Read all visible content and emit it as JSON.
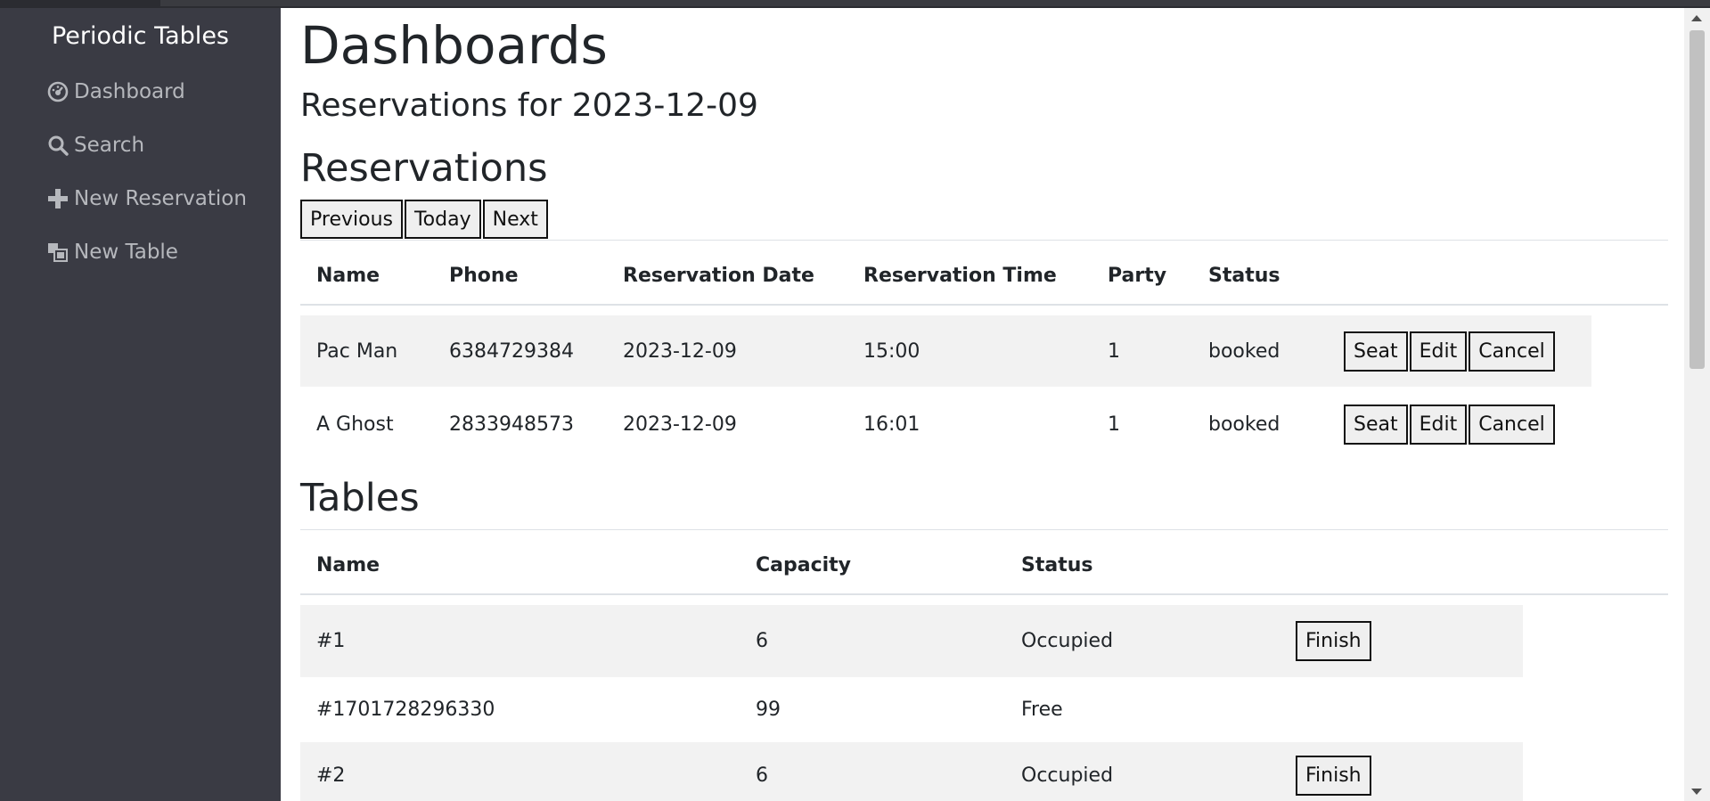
{
  "sidebar": {
    "brand": "Periodic Tables",
    "items": [
      {
        "label": "Dashboard",
        "icon": "dashboard-icon"
      },
      {
        "label": "Search",
        "icon": "search-icon"
      },
      {
        "label": "New Reservation",
        "icon": "plus-icon"
      },
      {
        "label": "New Table",
        "icon": "layers-icon"
      }
    ]
  },
  "main": {
    "title": "Dashboards",
    "subtitle": "Reservations for 2023-12-09",
    "reservations_heading": "Reservations",
    "nav_buttons": {
      "previous": "Previous",
      "today": "Today",
      "next": "Next"
    },
    "reservations": {
      "columns": [
        "Name",
        "Phone",
        "Reservation Date",
        "Reservation Time",
        "Party",
        "Status"
      ],
      "rows": [
        {
          "name": "Pac Man",
          "phone": "6384729384",
          "date": "2023-12-09",
          "time": "15:00",
          "party": "1",
          "status": "booked"
        },
        {
          "name": "A Ghost",
          "phone": "2833948573",
          "date": "2023-12-09",
          "time": "16:01",
          "party": "1",
          "status": "booked"
        }
      ],
      "actions": {
        "seat": "Seat",
        "edit": "Edit",
        "cancel": "Cancel"
      }
    },
    "tables_heading": "Tables",
    "tables": {
      "columns": [
        "Name",
        "Capacity",
        "Status"
      ],
      "rows": [
        {
          "name": "#1",
          "capacity": "6",
          "status": "Occupied",
          "action": "Finish"
        },
        {
          "name": "#1701728296330",
          "capacity": "99",
          "status": "Free",
          "action": ""
        },
        {
          "name": "#2",
          "capacity": "6",
          "status": "Occupied",
          "action": "Finish"
        }
      ]
    }
  },
  "colors": {
    "sidebar_bg": "#3a3b44",
    "sidebar_text": "#b6b8bd",
    "stripe": "#f2f2f2"
  }
}
